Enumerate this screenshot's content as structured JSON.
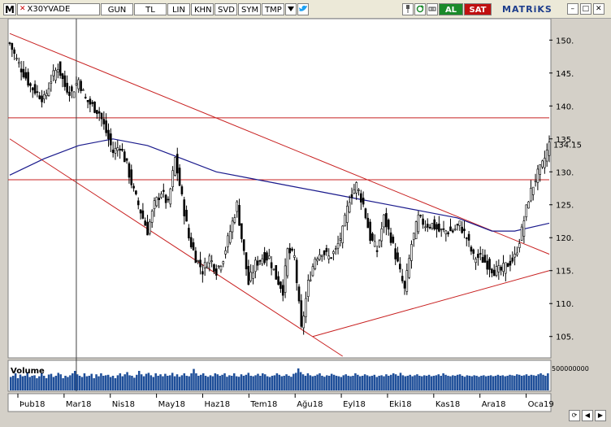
{
  "toolbar": {
    "m_label": "M",
    "symbol": "X30YVADE",
    "period": "GUN",
    "currency": "TL",
    "scale_lin": "LIN",
    "khn": "KHN",
    "svd": "SVD",
    "sym": "SYM",
    "tmp": "TMP",
    "al_label": "AL",
    "sat_label": "SAT",
    "brand": "MATRiKS",
    "colors": {
      "al": "#1a8a2a",
      "sat": "#c01010",
      "brand": "#1d3d8c"
    }
  },
  "chart_data": {
    "type": "candlestick",
    "last_price_label": "134.15",
    "y_ticks": [
      "150.",
      "145.",
      "140.",
      "135.",
      "130.",
      "125.",
      "120.",
      "115.",
      "110.",
      "105."
    ],
    "ylim": [
      102,
      153
    ],
    "x_ticks": [
      "Þub18",
      "Mar18",
      "Nis18",
      "May18",
      "Haz18",
      "Tem18",
      "Ağu18",
      "Eyl18",
      "Eki18",
      "Kas18",
      "Ara18",
      "Oca19"
    ],
    "close_path": [
      [
        0,
        149.5
      ],
      [
        3,
        147
      ],
      [
        6,
        145
      ],
      [
        9,
        143
      ],
      [
        12,
        142
      ],
      [
        15,
        141
      ],
      [
        18,
        144
      ],
      [
        21,
        146
      ],
      [
        24,
        143
      ],
      [
        27,
        142
      ],
      [
        30,
        144
      ],
      [
        33,
        141
      ],
      [
        36,
        140
      ],
      [
        39,
        139
      ],
      [
        42,
        136
      ],
      [
        45,
        133
      ],
      [
        48,
        134
      ],
      [
        51,
        131
      ],
      [
        54,
        127
      ],
      [
        57,
        124
      ],
      [
        60,
        121
      ],
      [
        63,
        125
      ],
      [
        66,
        127
      ],
      [
        69,
        125
      ],
      [
        72,
        132
      ],
      [
        75,
        126
      ],
      [
        78,
        120
      ],
      [
        81,
        117
      ],
      [
        84,
        115
      ],
      [
        87,
        117
      ],
      [
        90,
        115
      ],
      [
        93,
        117
      ],
      [
        96,
        121
      ],
      [
        99,
        125
      ],
      [
        101,
        120
      ],
      [
        104,
        113
      ],
      [
        107,
        116
      ],
      [
        110,
        117
      ],
      [
        113,
        117
      ],
      [
        116,
        114
      ],
      [
        119,
        112
      ],
      [
        121,
        118
      ],
      [
        124,
        117
      ],
      [
        127,
        106
      ],
      [
        130,
        113
      ],
      [
        133,
        117
      ],
      [
        136,
        118
      ],
      [
        139,
        117
      ],
      [
        142,
        118
      ],
      [
        145,
        121
      ],
      [
        148,
        126
      ],
      [
        151,
        128
      ],
      [
        154,
        125
      ],
      [
        157,
        120
      ],
      [
        160,
        118
      ],
      [
        163,
        123
      ],
      [
        166,
        120
      ],
      [
        169,
        116
      ],
      [
        172,
        112
      ],
      [
        175,
        119
      ],
      [
        178,
        123
      ],
      [
        181,
        122
      ],
      [
        184,
        122
      ],
      [
        187,
        121
      ],
      [
        190,
        121
      ],
      [
        193,
        121
      ],
      [
        196,
        122
      ],
      [
        199,
        120
      ],
      [
        202,
        117
      ],
      [
        205,
        117
      ],
      [
        208,
        116
      ],
      [
        211,
        115
      ],
      [
        214,
        115
      ],
      [
        217,
        116
      ],
      [
        220,
        117
      ],
      [
        223,
        121
      ],
      [
        226,
        126
      ],
      [
        229,
        129
      ],
      [
        232,
        131
      ],
      [
        235,
        134.15
      ]
    ],
    "moving_average": [
      [
        0,
        129.5
      ],
      [
        15,
        132
      ],
      [
        30,
        134
      ],
      [
        45,
        135
      ],
      [
        60,
        134
      ],
      [
        75,
        132
      ],
      [
        90,
        130
      ],
      [
        105,
        129
      ],
      [
        120,
        128
      ],
      [
        135,
        127
      ],
      [
        150,
        126
      ],
      [
        165,
        125
      ],
      [
        180,
        124
      ],
      [
        195,
        123
      ],
      [
        210,
        121
      ],
      [
        220,
        121
      ],
      [
        235,
        122.2
      ]
    ],
    "channel_upper": [
      [
        0,
        151
      ],
      [
        235,
        117.5
      ]
    ],
    "channel_lower_left": [
      [
        0,
        135
      ],
      [
        145,
        102
      ]
    ],
    "channel_lower_right": [
      [
        132,
        105
      ],
      [
        235,
        115
      ]
    ],
    "horizontal_levels": [
      138.2,
      128.8
    ],
    "vertical_marker_day": 29,
    "colors": {
      "price": "#000000",
      "moving_average": "#1a1a8c",
      "trendlines": "#c82020",
      "volume": "#1f4f99",
      "cursor": "#404040"
    },
    "volume": {
      "title": "Volume",
      "axis_label": "500000000",
      "values": [
        0.55,
        0.6,
        0.7,
        0.5,
        0.65,
        0.58,
        0.6,
        0.72,
        0.55,
        0.6,
        0.62,
        0.5,
        0.58,
        0.7,
        0.6,
        0.5,
        0.65,
        0.68,
        0.55,
        0.6,
        0.72,
        0.66,
        0.5,
        0.6,
        0.55,
        0.62,
        0.7,
        0.8,
        0.66,
        0.6,
        0.55,
        0.7,
        0.58,
        0.6,
        0.68,
        0.5,
        0.66,
        0.58,
        0.7,
        0.6,
        0.62,
        0.64,
        0.55,
        0.6,
        0.5,
        0.62,
        0.7,
        0.58,
        0.66,
        0.75,
        0.62,
        0.6,
        0.52,
        0.64,
        0.8,
        0.66,
        0.58,
        0.68,
        0.72,
        0.62,
        0.55,
        0.7,
        0.6,
        0.66,
        0.58,
        0.68,
        0.6,
        0.62,
        0.72,
        0.58,
        0.66,
        0.56,
        0.62,
        0.7,
        0.6,
        0.58,
        0.7,
        0.88,
        0.7,
        0.6,
        0.64,
        0.7,
        0.6,
        0.56,
        0.62,
        0.58,
        0.7,
        0.66,
        0.6,
        0.64,
        0.7,
        0.56,
        0.62,
        0.6,
        0.7,
        0.58,
        0.56,
        0.66,
        0.6,
        0.64,
        0.72,
        0.6,
        0.58,
        0.62,
        0.68,
        0.6,
        0.7,
        0.66,
        0.58,
        0.55,
        0.6,
        0.62,
        0.7,
        0.64,
        0.58,
        0.6,
        0.66,
        0.6,
        0.56,
        0.68,
        0.72,
        0.9,
        0.75,
        0.66,
        0.6,
        0.7,
        0.62,
        0.58,
        0.6,
        0.65,
        0.7,
        0.6,
        0.56,
        0.62,
        0.6,
        0.68,
        0.64,
        0.6,
        0.58,
        0.55,
        0.62,
        0.66,
        0.6,
        0.58,
        0.6,
        0.7,
        0.64,
        0.58,
        0.6,
        0.66,
        0.62,
        0.58,
        0.6,
        0.64,
        0.55,
        0.6,
        0.62,
        0.58,
        0.66,
        0.6,
        0.64,
        0.7,
        0.66,
        0.6,
        0.72,
        0.62,
        0.58,
        0.6,
        0.64,
        0.58,
        0.62,
        0.66,
        0.6,
        0.58,
        0.62,
        0.6,
        0.64,
        0.58,
        0.6,
        0.62,
        0.66,
        0.6,
        0.7,
        0.64,
        0.6,
        0.58,
        0.62,
        0.6,
        0.64,
        0.66,
        0.6,
        0.56,
        0.62,
        0.6,
        0.58,
        0.62,
        0.6,
        0.56,
        0.6,
        0.62,
        0.58,
        0.6,
        0.62,
        0.58,
        0.6,
        0.64,
        0.6,
        0.62,
        0.58,
        0.6,
        0.64,
        0.62,
        0.6,
        0.66,
        0.64,
        0.6,
        0.62,
        0.66,
        0.6,
        0.64,
        0.62,
        0.6,
        0.66,
        0.7,
        0.64,
        0.6,
        0.7
      ]
    }
  }
}
